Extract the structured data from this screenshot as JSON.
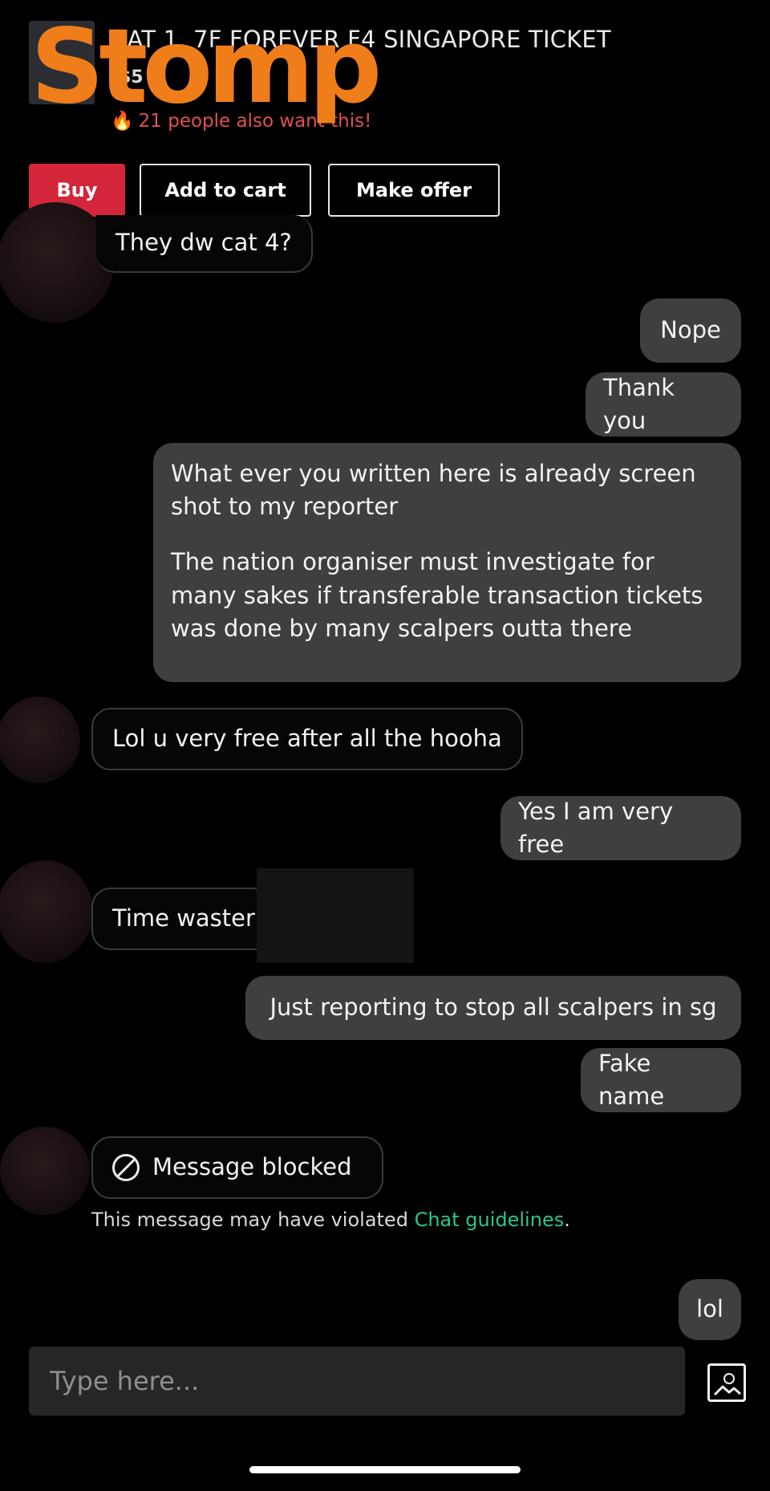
{
  "listing": {
    "title": "CAT 1, 7F FOREVER F4 SINGAPORE TICKET",
    "price": "$5",
    "interest": "21 people also want this!"
  },
  "watermark": {
    "text": "Stomp"
  },
  "actions": {
    "buy": "Buy",
    "add_to_cart": "Add to cart",
    "make_offer": "Make offer"
  },
  "messages": [
    {
      "side": "received",
      "text": "They dw cat 4?"
    },
    {
      "side": "sent",
      "text": "Nope"
    },
    {
      "side": "sent",
      "text": "Thank you"
    },
    {
      "side": "sent",
      "paragraphs": [
        "What ever you written here is already screen shot to my reporter",
        "The nation organiser must investigate for many sakes if transferable transaction tickets was done by many scalpers outta there"
      ]
    },
    {
      "side": "received",
      "text": "Lol u very free after all the hooha"
    },
    {
      "side": "sent",
      "text": "Yes I am very free"
    },
    {
      "side": "received",
      "text": "Time waster"
    },
    {
      "side": "sent",
      "text": "Just reporting  to stop all scalpers in sg"
    },
    {
      "side": "sent",
      "text": "Fake name"
    },
    {
      "side": "received",
      "text": "Message blocked",
      "blocked": true
    },
    {
      "side": "sent",
      "text": "lol"
    }
  ],
  "notice": {
    "prefix": "This message may have violated ",
    "link": "Chat guidelines",
    "suffix": "."
  },
  "composer": {
    "placeholder": "Type here..."
  },
  "icons": {
    "image": "image-icon",
    "block": "block-icon",
    "flame": "fire-icon"
  },
  "colors": {
    "buy": "#d4263a",
    "link": "#2ec48a",
    "interest": "#e0524f",
    "watermark": "#ef7d1a",
    "sent_bubble": "#3f3f3f"
  }
}
